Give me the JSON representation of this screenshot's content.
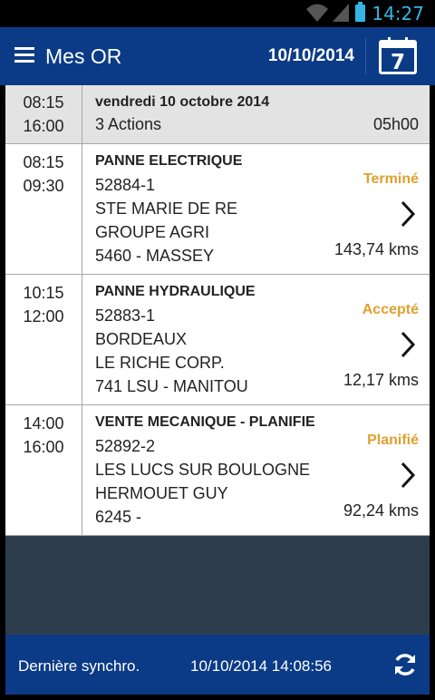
{
  "status_bar": {
    "time": "14:27"
  },
  "app_bar": {
    "title": "Mes OR",
    "date": "10/10/2014",
    "calendar_day": "7"
  },
  "day_header": {
    "start": "08:15",
    "end": "16:00",
    "date_label": "vendredi 10 octobre 2014",
    "actions_label": "3 Actions",
    "duration": "05h00"
  },
  "jobs": [
    {
      "start": "08:15",
      "end": "09:30",
      "title": "PANNE ELECTRIQUE",
      "number": "52884-1",
      "location": "STE MARIE DE RE",
      "client": "GROUPE AGRI",
      "machine": "5460 - MASSEY",
      "status": "Terminé",
      "distance": "143,74 kms"
    },
    {
      "start": "10:15",
      "end": "12:00",
      "title": "PANNE HYDRAULIQUE",
      "number": "52883-1",
      "location": "BORDEAUX",
      "client": "LE RICHE CORP.",
      "machine": "741 LSU - MANITOU",
      "status": "Accepté",
      "distance": "12,17 kms"
    },
    {
      "start": "14:00",
      "end": "16:00",
      "title": "VENTE MECANIQUE - PLANIFIE",
      "number": "52892-2",
      "location": "LES LUCS SUR BOULOGNE",
      "client": "HERMOUET GUY",
      "machine": "6245 -",
      "status": "Planifié",
      "distance": "92,24 kms"
    }
  ],
  "footer": {
    "sync_label": "Dernière synchro.",
    "sync_datetime": "10/10/2014 14:08:56"
  },
  "colors": {
    "primary": "#0b3b86",
    "status_accent": "#e0a030",
    "status_bar_accent": "#33b5e5",
    "empty_area": "#2d3d4c",
    "day_header_bg": "#e3e3e3"
  }
}
